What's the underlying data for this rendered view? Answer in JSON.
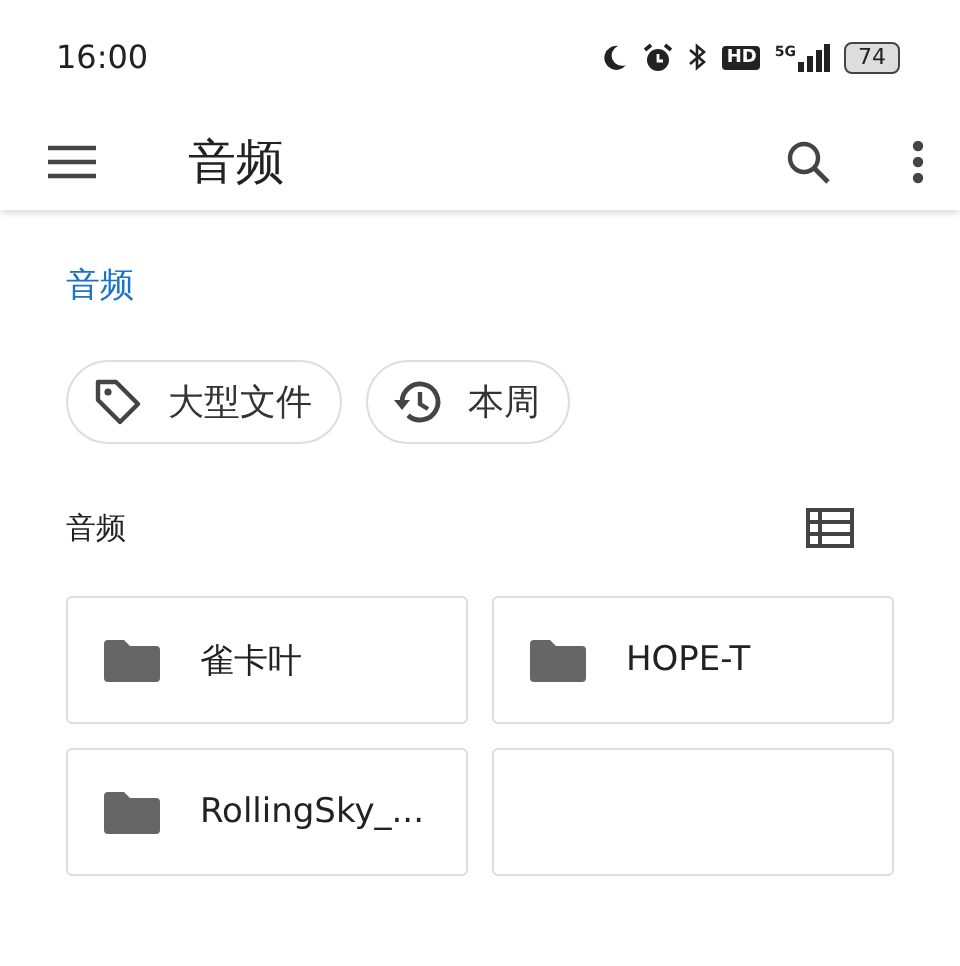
{
  "status_bar": {
    "time": "16:00",
    "hd": "HD",
    "network": "5G",
    "battery": "74"
  },
  "app_bar": {
    "title": "音频"
  },
  "breadcrumb": "音频",
  "chips": [
    {
      "kind": "tag",
      "label": "大型文件"
    },
    {
      "kind": "history",
      "label": "本周"
    }
  ],
  "section": {
    "title": "音频"
  },
  "folders": [
    {
      "kind": "folder",
      "name": "雀卡叶"
    },
    {
      "kind": "folder",
      "name": "HOPE-T"
    },
    {
      "kind": "folder",
      "name": "RollingSky_..."
    },
    {
      "kind": "blank"
    }
  ]
}
